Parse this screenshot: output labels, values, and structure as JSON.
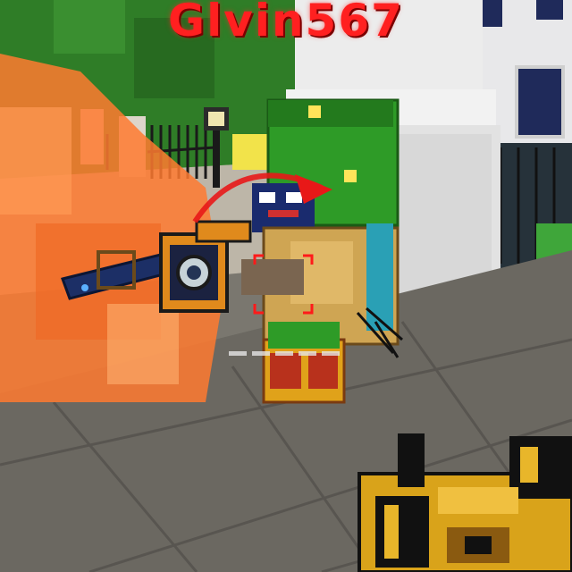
{
  "hud": {
    "player_name": "Glvin567",
    "name_color": "#ff2020"
  },
  "scene": {
    "icons": [
      "crosshair-icon",
      "enemy-player",
      "first-person-weapon",
      "dropped-weapon",
      "lamp-post",
      "iron-fence",
      "flame-hazard"
    ],
    "colors": {
      "hedge": "#2f7d27",
      "building": "#e6e6e6",
      "floor": "#6f6c66",
      "fire": "#ff7a30",
      "gold": "#d9a31a"
    }
  }
}
